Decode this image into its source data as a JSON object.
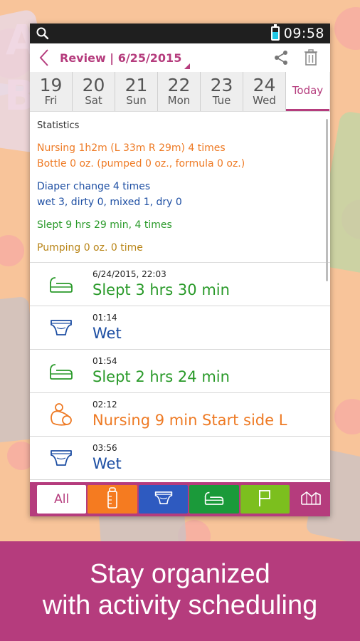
{
  "status_bar": {
    "time": "09:58",
    "search_icon": "search-icon",
    "battery_icon": "battery-icon"
  },
  "header": {
    "title": "Review | 6/25/2015",
    "back_icon": "chevron-left-icon",
    "share_icon": "share-icon",
    "delete_icon": "trash-icon"
  },
  "dates": [
    {
      "num": "19",
      "dow": "Fri"
    },
    {
      "num": "20",
      "dow": "Sat"
    },
    {
      "num": "21",
      "dow": "Sun"
    },
    {
      "num": "22",
      "dow": "Mon"
    },
    {
      "num": "23",
      "dow": "Tue"
    },
    {
      "num": "24",
      "dow": "Wed"
    }
  ],
  "today_label": "Today",
  "statistics": {
    "heading": "Statistics",
    "nursing": "Nursing 1h2m (L 33m  R 29m)  4 times",
    "bottle": "Bottle 0 oz. (pumped 0 oz., formula 0 oz.)",
    "diaper": "Diaper change 4 times",
    "diaper_detail": "wet 3, dirty 0, mixed 1, dry 0",
    "sleep": "Slept 9 hrs 29 min,  4 times",
    "pumping": "Pumping 0 oz. 0 time"
  },
  "entries": [
    {
      "time": "6/24/2015, 22:03",
      "label": "Slept 3 hrs 30 min",
      "icon": "sleep-icon"
    },
    {
      "time": "01:14",
      "label": "Wet",
      "icon": "diaper-icon"
    },
    {
      "time": "01:54",
      "label": "Slept 2 hrs 24 min",
      "icon": "sleep-icon"
    },
    {
      "time": "02:12",
      "label": "Nursing  9 min Start side L",
      "icon": "nursing-icon"
    },
    {
      "time": "03:56",
      "label": "Wet",
      "icon": "diaper-icon"
    }
  ],
  "filter_tabs": {
    "all": "All",
    "bottle_icon": "bottle-icon",
    "diaper_icon": "diaper-icon",
    "sleep_icon": "sleep-icon",
    "flag_icon": "flag-icon",
    "chart_icon": "chart-icon"
  },
  "banner": {
    "line1": "Stay organized",
    "line2": "with activity scheduling"
  },
  "colors": {
    "accent": "#b53c7d",
    "nursing": "#ee7a24",
    "diaper": "#1e4fa3",
    "sleep": "#2a9a2a",
    "pumping": "#b88416"
  }
}
